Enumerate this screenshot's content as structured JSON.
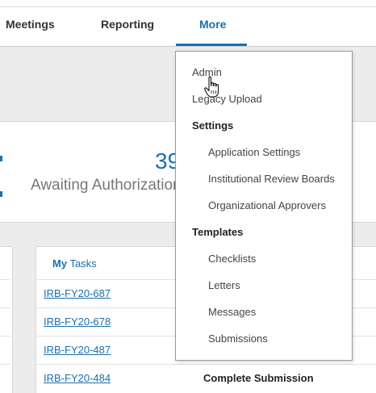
{
  "nav": {
    "items": [
      "Meetings",
      "Reporting",
      "More"
    ],
    "active": "More"
  },
  "stats": {
    "number": "39",
    "label": "Awaiting Authorization"
  },
  "tasks": {
    "title_first": "My",
    "title_rest": " Tasks",
    "rows": [
      {
        "id": "IRB-FY20-687",
        "action": ""
      },
      {
        "id": "IRB-FY20-678",
        "action": ""
      },
      {
        "id": "IRB-FY20-487",
        "action": ""
      },
      {
        "id": "IRB-FY20-484",
        "action": "Complete Submission"
      }
    ]
  },
  "menu": {
    "admin": "Admin",
    "legacy_upload": "Legacy Upload",
    "settings_heading": "Settings",
    "settings": [
      "Application Settings",
      "Institutional Review Boards",
      "Organizational Approvers"
    ],
    "templates_heading": "Templates",
    "templates": [
      "Checklists",
      "Letters",
      "Messages",
      "Submissions"
    ]
  },
  "colors": {
    "accent": "#1b6fae",
    "band": "#ececec"
  },
  "icons": {
    "cursor": "hand-pointer-icon",
    "stats": "document-icon"
  }
}
